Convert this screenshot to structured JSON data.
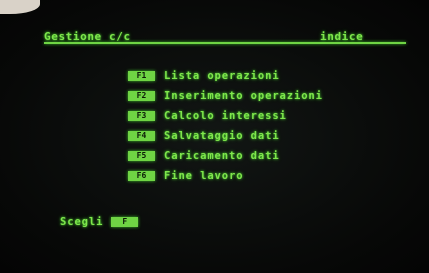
{
  "screen": {
    "title": "Gestione c/c",
    "section": "indice"
  },
  "menu": {
    "items": [
      {
        "key": "F1",
        "label": "Lista operazioni"
      },
      {
        "key": "F2",
        "label": "Inserimento operazioni"
      },
      {
        "key": "F3",
        "label": "Calcolo interessi"
      },
      {
        "key": "F4",
        "label": "Salvataggio dati"
      },
      {
        "key": "F5",
        "label": "Caricamento dati"
      },
      {
        "key": "F6",
        "label": "Fine lavoro"
      }
    ]
  },
  "prompt": {
    "label": "Scegli",
    "cursor": "F"
  },
  "colors": {
    "phosphor": "#7fe64c",
    "background": "#0c0b0b"
  }
}
